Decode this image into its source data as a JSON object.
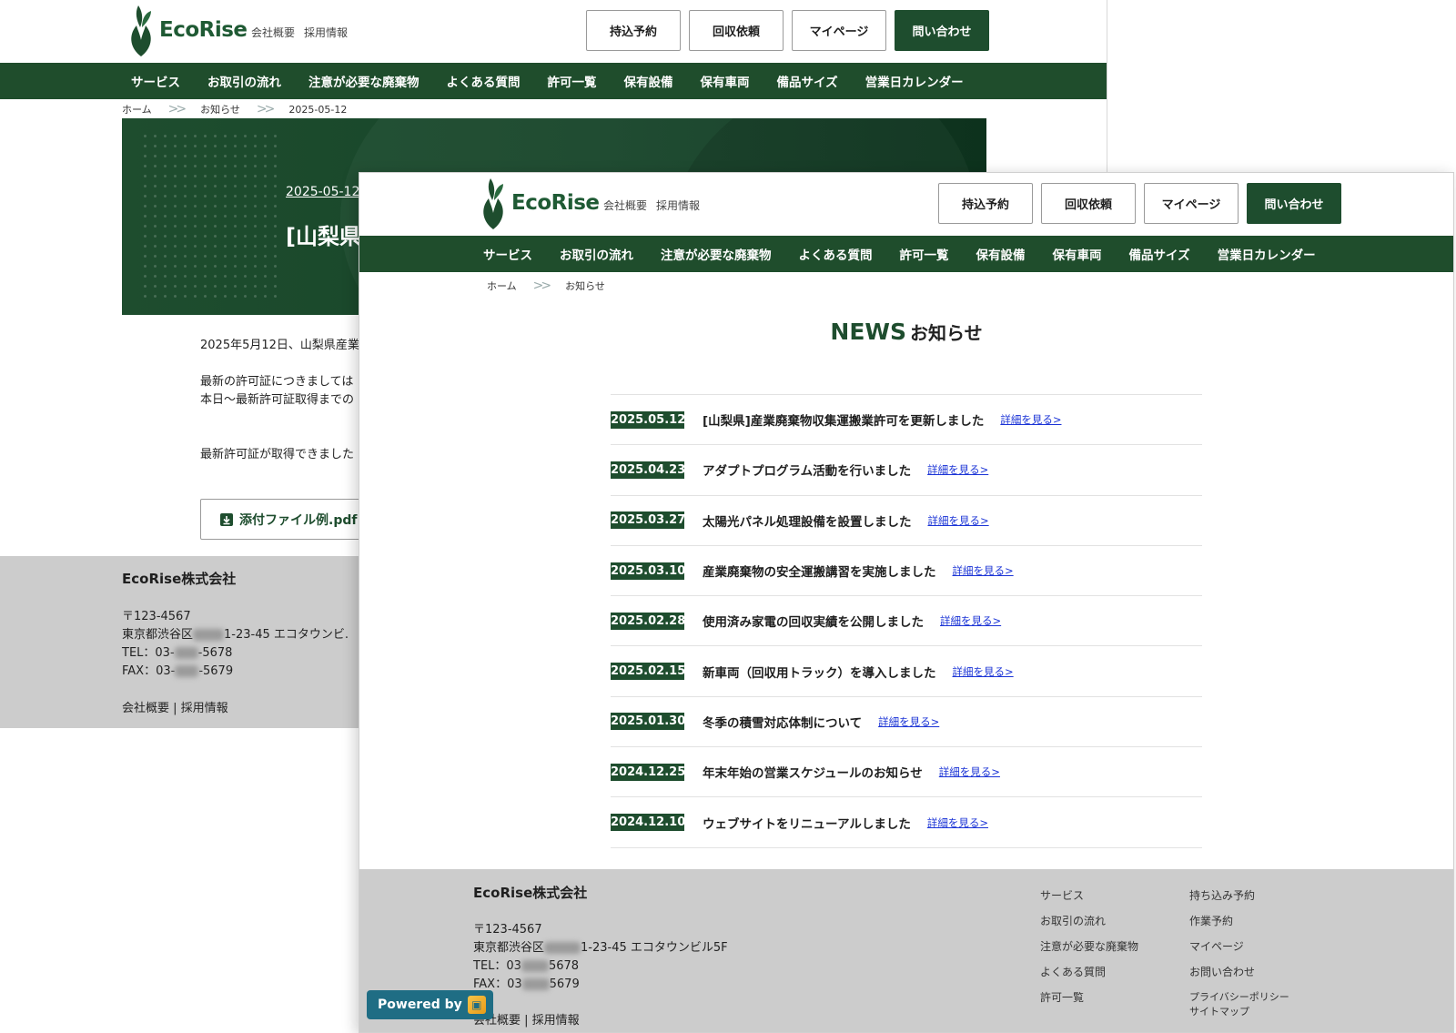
{
  "brand": {
    "logo_text": "EcoRise",
    "primary_color": "#1e4d2e",
    "link_color": "#1a33d6"
  },
  "header": {
    "sub_links": [
      "会社概要",
      "採用情報"
    ],
    "buttons": [
      "持込予約",
      "回収依頼",
      "マイページ",
      "問い合わせ"
    ]
  },
  "nav": [
    "サービス",
    "お取引の流れ",
    "注意が必要な廃棄物",
    "よくある質問",
    "許可一覧",
    "保有設備",
    "保有車両",
    "備品サイズ",
    "営業日カレンダー"
  ],
  "back": {
    "breadcrumb": [
      "ホーム",
      "お知らせ",
      "2025-05-12"
    ],
    "hero": {
      "date": "2025-05-12",
      "title": "[山梨県"
    },
    "body": {
      "p1": "2025年5月12日、山梨県産業",
      "p2a": "最新の許可証につきましては",
      "p2b": "本日〜最新許可証取得までの",
      "p3": "最新許可証が取得できました"
    },
    "attachment": "添付ファイル例.pdf",
    "footer": {
      "company": "EcoRise株式会社",
      "zip": "〒123-4567",
      "addr_a": "東京都渋谷区",
      "addr_b": "1-23-45 エコタウンビ.",
      "tel_a": "TEL：03-",
      "tel_b": "-5678",
      "fax_a": "FAX：03-",
      "fax_b": "-5679",
      "links": "会社概要 | 採用情報"
    }
  },
  "front": {
    "breadcrumb": [
      "ホーム",
      "お知らせ"
    ],
    "heading_en": "NEWS",
    "heading_jp": "お知らせ",
    "news": [
      {
        "date": "2025.05.12",
        "title": "[山梨県]産業廃棄物収集運搬業許可を更新しました",
        "link": "詳細を見る>"
      },
      {
        "date": "2025.04.23",
        "title": "アダプトプログラム活動を行いました",
        "link": "詳細を見る>"
      },
      {
        "date": "2025.03.27",
        "title": "太陽光パネル処理設備を設置しました",
        "link": "詳細を見る>"
      },
      {
        "date": "2025.03.10",
        "title": "産業廃棄物の安全運搬講習を実施しました",
        "link": "詳細を見る>"
      },
      {
        "date": "2025.02.28",
        "title": "使用済み家電の回収実績を公開しました",
        "link": "詳細を見る>"
      },
      {
        "date": "2025.02.15",
        "title": "新車両（回収用トラック）を導入しました",
        "link": "詳細を見る>"
      },
      {
        "date": "2025.01.30",
        "title": "冬季の積雪対応体制について",
        "link": "詳細を見る>"
      },
      {
        "date": "2024.12.25",
        "title": "年末年始の営業スケジュールのお知らせ",
        "link": "詳細を見る>"
      },
      {
        "date": "2024.12.10",
        "title": "ウェブサイトをリニューアルしました",
        "link": "詳細を見る>"
      }
    ],
    "footer": {
      "company": "EcoRise株式会社",
      "zip": "〒123-4567",
      "addr_a": "東京都渋谷区",
      "addr_b": "1-23-45 エコタウンビル5F",
      "tel_a": "TEL：03",
      "tel_b": "5678",
      "fax_a": "FAX：03",
      "fax_b": "5679",
      "links": "会社概要 | 採用情報",
      "col1": [
        "サービス",
        "お取引の流れ",
        "注意が必要な廃棄物",
        "よくある質問",
        "許可一覧"
      ],
      "col2": [
        "持ち込み予約",
        "作業予約",
        "マイページ",
        "お問い合わせ",
        "プライバシーポリシー",
        "サイトマップ"
      ]
    },
    "powered_by": "Powered by"
  }
}
